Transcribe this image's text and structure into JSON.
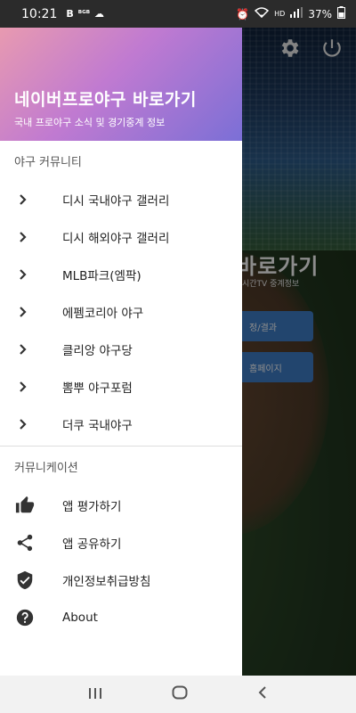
{
  "status_bar": {
    "time": "10:21",
    "left_icons": [
      "B",
      "ᴮᴳᴮ",
      "●"
    ],
    "battery": "37%"
  },
  "background": {
    "title": "바로가기",
    "subtitle": "시간TV 중계정보",
    "button1": "정/결과",
    "button2": "홈페이지"
  },
  "drawer": {
    "title": "네이버프로야구 바로가기",
    "subtitle": "국내 프로야구 소식 및 경기중계 정보",
    "section1": "야구 커뮤니티",
    "community_items": [
      {
        "label": "디시 국내야구 갤러리"
      },
      {
        "label": "디시 해외야구 갤러리"
      },
      {
        "label": "MLB파크(엠팍)"
      },
      {
        "label": "에펨코리아 야구"
      },
      {
        "label": "클리앙 야구당"
      },
      {
        "label": "뽐뿌 야구포럼"
      },
      {
        "label": "더쿠 국내야구"
      }
    ],
    "section2": "커뮤니케이션",
    "communication_items": [
      {
        "label": "앱 평가하기",
        "icon": "thumb-up-icon"
      },
      {
        "label": "앱 공유하기",
        "icon": "share-icon"
      },
      {
        "label": "개인정보취급방침",
        "icon": "verified-shield-icon"
      },
      {
        "label": "About",
        "icon": "help-icon"
      }
    ]
  },
  "colors": {
    "header_gradient_start": "#e89ab0",
    "header_gradient_end": "#7b6fd6",
    "bg_button": "#3f7fc8"
  }
}
